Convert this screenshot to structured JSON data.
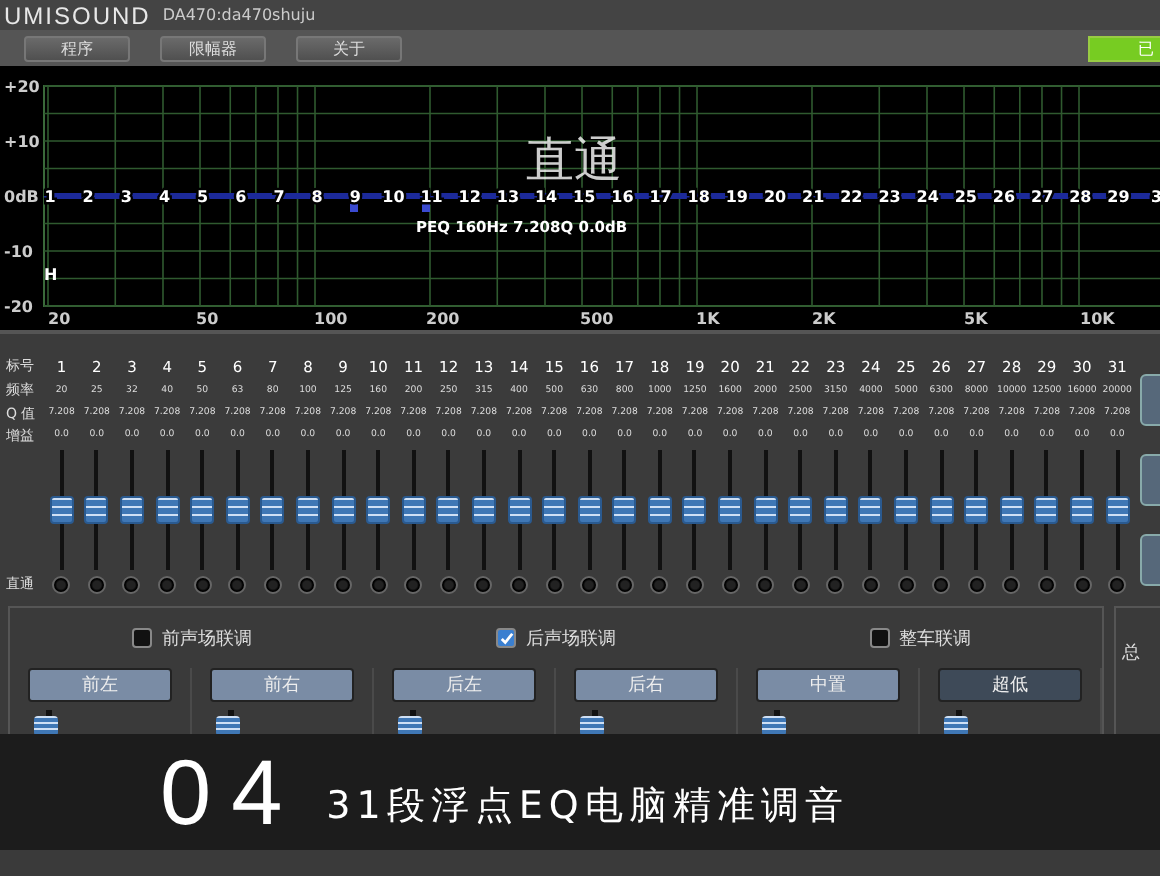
{
  "header": {
    "logo": "UMISOUND",
    "device": "DA470:da470shuju"
  },
  "menu": [
    "程序",
    "限幅器",
    "关于"
  ],
  "status_button": "已",
  "graph": {
    "y_labels": [
      "+20",
      "+10",
      "0dB",
      "-10",
      "-20"
    ],
    "x_labels": [
      "20",
      "50",
      "100",
      "200",
      "500",
      "1K",
      "2K",
      "5K",
      "10K"
    ],
    "band_markers": [
      "1",
      "2",
      "3",
      "4",
      "5",
      "6",
      "7",
      "8",
      "9",
      "10",
      "11",
      "12",
      "13",
      "14",
      "15",
      "16",
      "17",
      "18",
      "19",
      "20",
      "21",
      "22",
      "23",
      "24",
      "25",
      "26",
      "27",
      "28",
      "29",
      "3"
    ],
    "mode_label": "直通",
    "readout": "PEQ 160Hz 7.208Q 0.0dB",
    "marker": "H"
  },
  "bands_table": {
    "row_labels": [
      "标号",
      "频率",
      "Q 值",
      "增益"
    ],
    "bypass_label": "直通",
    "bands": [
      {
        "number": "1",
        "freq": "20",
        "q": "7.208",
        "gain": "0.0",
        "level": 0.5
      },
      {
        "number": "2",
        "freq": "25",
        "q": "7.208",
        "gain": "0.0",
        "level": 0.5
      },
      {
        "number": "3",
        "freq": "32",
        "q": "7.208",
        "gain": "0.0",
        "level": 0.5
      },
      {
        "number": "4",
        "freq": "40",
        "q": "7.208",
        "gain": "0.0",
        "level": 0.5
      },
      {
        "number": "5",
        "freq": "50",
        "q": "7.208",
        "gain": "0.0",
        "level": 0.5
      },
      {
        "number": "6",
        "freq": "63",
        "q": "7.208",
        "gain": "0.0",
        "level": 0.5
      },
      {
        "number": "7",
        "freq": "80",
        "q": "7.208",
        "gain": "0.0",
        "level": 0.5
      },
      {
        "number": "8",
        "freq": "100",
        "q": "7.208",
        "gain": "0.0",
        "level": 0.5
      },
      {
        "number": "9",
        "freq": "125",
        "q": "7.208",
        "gain": "0.0",
        "level": 0.5
      },
      {
        "number": "10",
        "freq": "160",
        "q": "7.208",
        "gain": "0.0",
        "level": 0.5
      },
      {
        "number": "11",
        "freq": "200",
        "q": "7.208",
        "gain": "0.0",
        "level": 0.5
      },
      {
        "number": "12",
        "freq": "250",
        "q": "7.208",
        "gain": "0.0",
        "level": 0.5
      },
      {
        "number": "13",
        "freq": "315",
        "q": "7.208",
        "gain": "0.0",
        "level": 0.5
      },
      {
        "number": "14",
        "freq": "400",
        "q": "7.208",
        "gain": "0.0",
        "level": 0.5
      },
      {
        "number": "15",
        "freq": "500",
        "q": "7.208",
        "gain": "0.0",
        "level": 0.5
      },
      {
        "number": "16",
        "freq": "630",
        "q": "7.208",
        "gain": "0.0",
        "level": 0.5
      },
      {
        "number": "17",
        "freq": "800",
        "q": "7.208",
        "gain": "0.0",
        "level": 0.5
      },
      {
        "number": "18",
        "freq": "1000",
        "q": "7.208",
        "gain": "0.0",
        "level": 0.5
      },
      {
        "number": "19",
        "freq": "1250",
        "q": "7.208",
        "gain": "0.0",
        "level": 0.5
      },
      {
        "number": "20",
        "freq": "1600",
        "q": "7.208",
        "gain": "0.0",
        "level": 0.5
      },
      {
        "number": "21",
        "freq": "2000",
        "q": "7.208",
        "gain": "0.0",
        "level": 0.5
      },
      {
        "number": "22",
        "freq": "2500",
        "q": "7.208",
        "gain": "0.0",
        "level": 0.5
      },
      {
        "number": "23",
        "freq": "3150",
        "q": "7.208",
        "gain": "0.0",
        "level": 0.5
      },
      {
        "number": "24",
        "freq": "4000",
        "q": "7.208",
        "gain": "0.0",
        "level": 0.5
      },
      {
        "number": "25",
        "freq": "5000",
        "q": "7.208",
        "gain": "0.0",
        "level": 0.5
      },
      {
        "number": "26",
        "freq": "6300",
        "q": "7.208",
        "gain": "0.0",
        "level": 0.5
      },
      {
        "number": "27",
        "freq": "8000",
        "q": "7.208",
        "gain": "0.0",
        "level": 0.5
      },
      {
        "number": "28",
        "freq": "10000",
        "q": "7.208",
        "gain": "0.0",
        "level": 0.5
      },
      {
        "number": "29",
        "freq": "12500",
        "q": "7.208",
        "gain": "0.0",
        "level": 0.5
      },
      {
        "number": "30",
        "freq": "16000",
        "q": "7.208",
        "gain": "0.0",
        "level": 0.5
      },
      {
        "number": "31",
        "freq": "20000",
        "q": "7.208",
        "gain": "0.0",
        "level": 0.5
      }
    ]
  },
  "link_options": [
    {
      "label": "前声场联调",
      "checked": false
    },
    {
      "label": "后声场联调",
      "checked": true
    },
    {
      "label": "整车联调",
      "checked": false
    }
  ],
  "channels": [
    {
      "name": "前左",
      "selected": false,
      "level": 0.92
    },
    {
      "name": "前右",
      "selected": false,
      "level": 0.92
    },
    {
      "name": "后左",
      "selected": false,
      "level": 0.92
    },
    {
      "name": "后右",
      "selected": false,
      "level": 0.92
    },
    {
      "name": "中置",
      "selected": false,
      "level": 0.92
    },
    {
      "name": "超低",
      "selected": true,
      "level": 0.92
    }
  ],
  "master": {
    "label": "总"
  },
  "caption": {
    "number": "04",
    "title": "31段浮点EQ电脑精准调音"
  }
}
